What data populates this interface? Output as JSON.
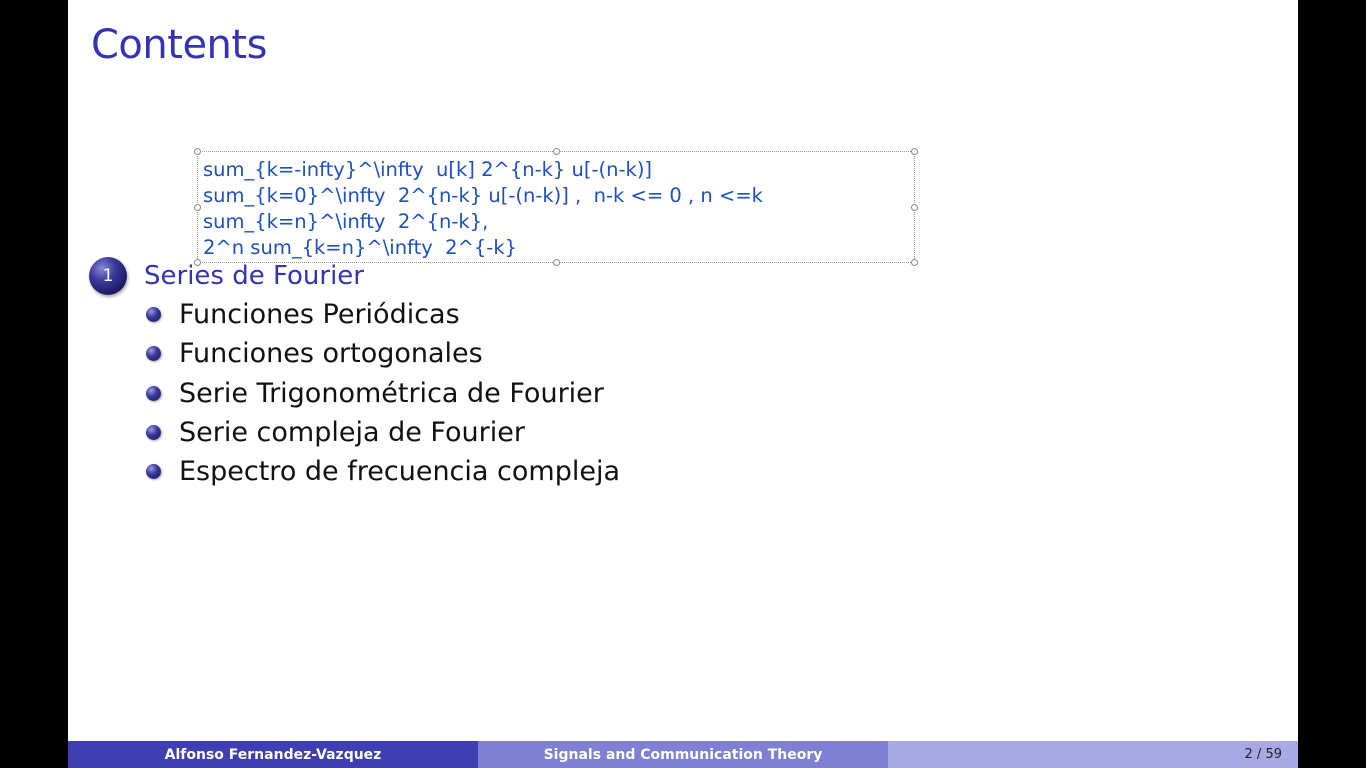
{
  "slide": {
    "frame_title": "Contents",
    "section": {
      "number": "1",
      "label": "Series de Fourier"
    },
    "subsections": [
      "Funciones Periódicas",
      "Funciones ortogonales",
      "Serie Trigonométrica de Fourier",
      "Serie compleja de Fourier",
      "Espectro de frecuencia compleja"
    ],
    "overlay_textbox": {
      "lines": [
        "sum_{k=-infty}^\\infty  u[k] 2^{n-k} u[-(n-k)]",
        "sum_{k=0}^\\infty  2^{n-k} u[-(n-k)] ,  n-k <= 0 , n <=k",
        "sum_{k=n}^\\infty  2^{n-k},",
        "2^n sum_{k=n}^\\infty  2^{-k}"
      ],
      "text_color": "#1f4fbf"
    }
  },
  "footer": {
    "author": "Alfonso Fernandez-Vazquez",
    "title": "Signals and Communication Theory",
    "page": "2 / 59"
  },
  "theme": {
    "title_color": "#3333b3",
    "footer_dark": "#3f3fb1",
    "footer_mid": "#7f7fd3",
    "footer_light": "#a8a8e2"
  }
}
